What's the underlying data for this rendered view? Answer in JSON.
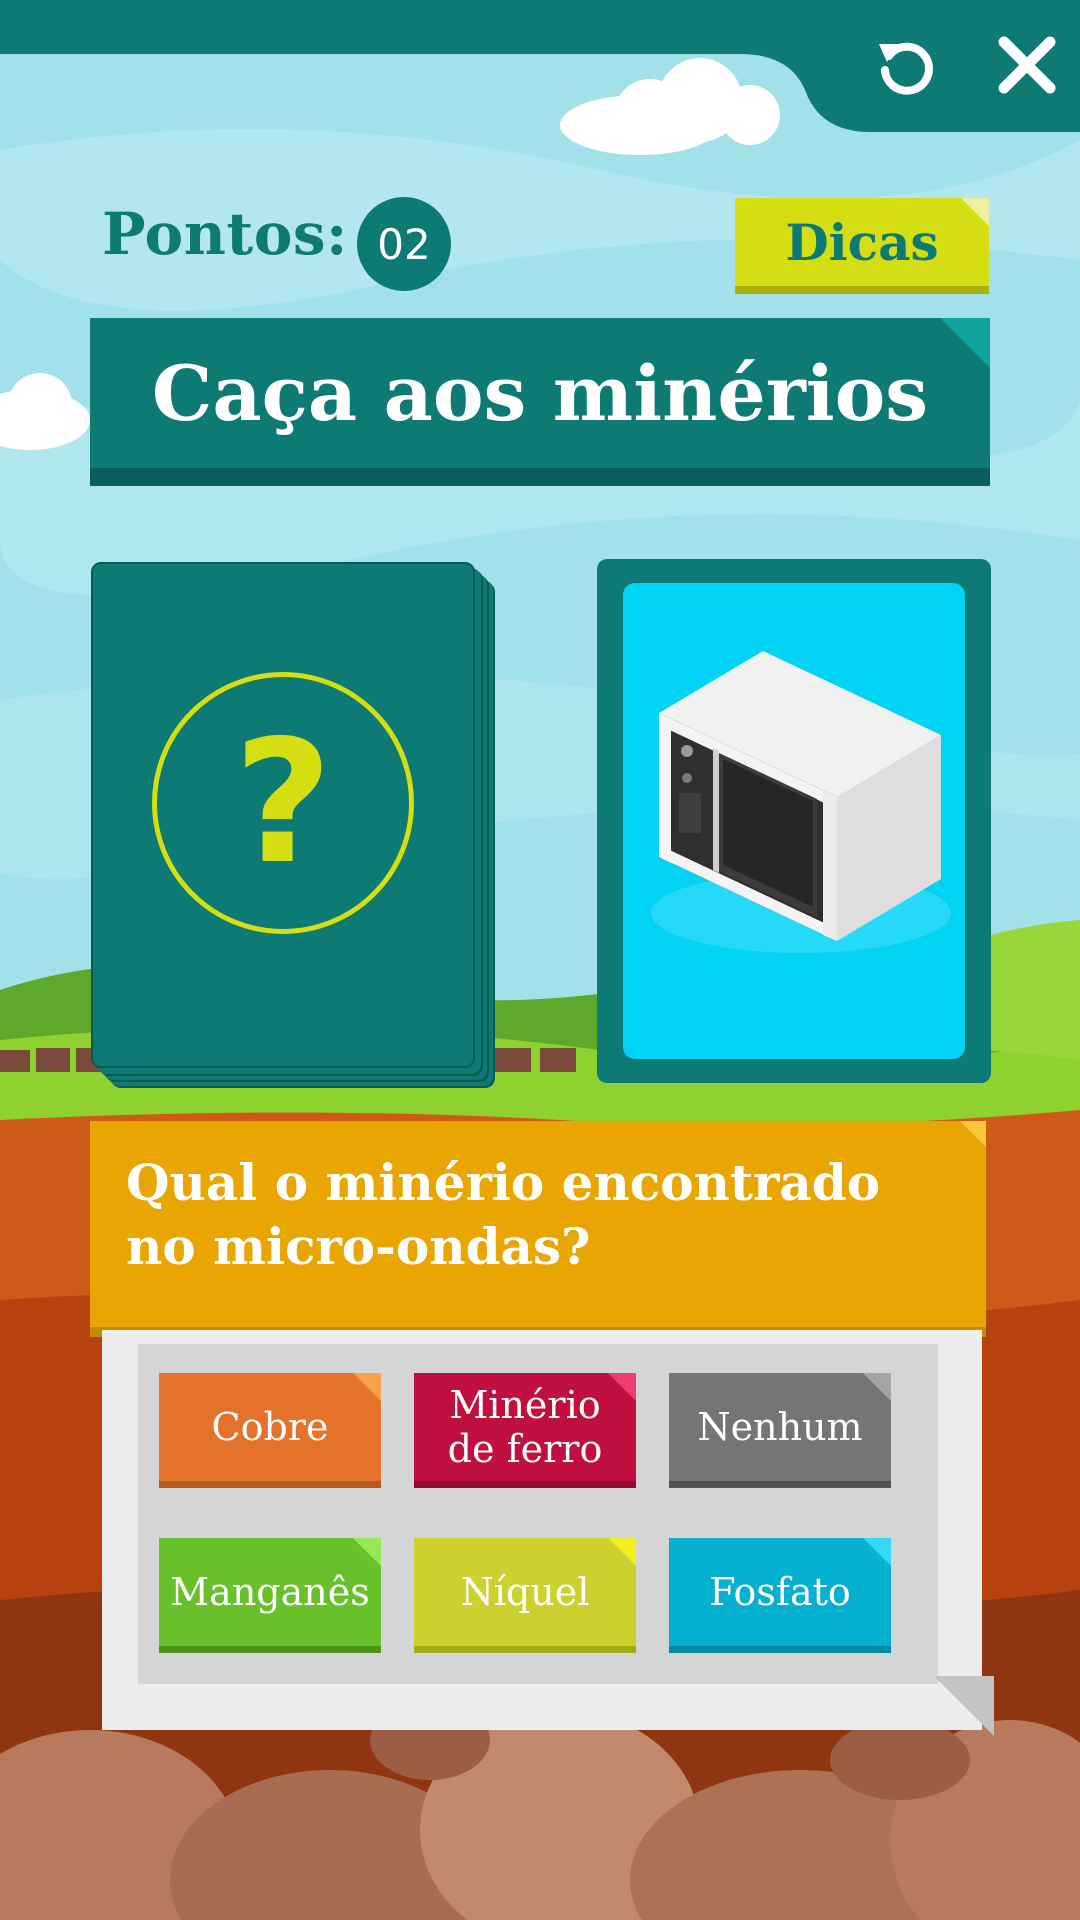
{
  "header": {
    "restart_icon": "restart-icon",
    "close_icon": "close-icon"
  },
  "score": {
    "label": "Pontos:",
    "value": "02"
  },
  "hints": {
    "label": "Dicas"
  },
  "title": "Caça aos minérios",
  "cards": {
    "deck_symbol": "?",
    "object_icon": "microwave-icon"
  },
  "question": "Qual o minério encontrado no micro-ondas?",
  "answers": [
    {
      "label": "Cobre",
      "color": "#e5722b"
    },
    {
      "label": "Minério de ferro",
      "color": "#c10f40"
    },
    {
      "label": "Nenhum",
      "color": "#747577"
    },
    {
      "label": "Manganês",
      "color": "#68c02a"
    },
    {
      "label": "Níquel",
      "color": "#cdd12f"
    },
    {
      "label": "Fosfato",
      "color": "#06b0d1"
    }
  ],
  "colors": {
    "primary": "#0d7a74",
    "accent": "#d4de12",
    "question_bg": "#e9a502",
    "sky": "#a3e1ea"
  }
}
